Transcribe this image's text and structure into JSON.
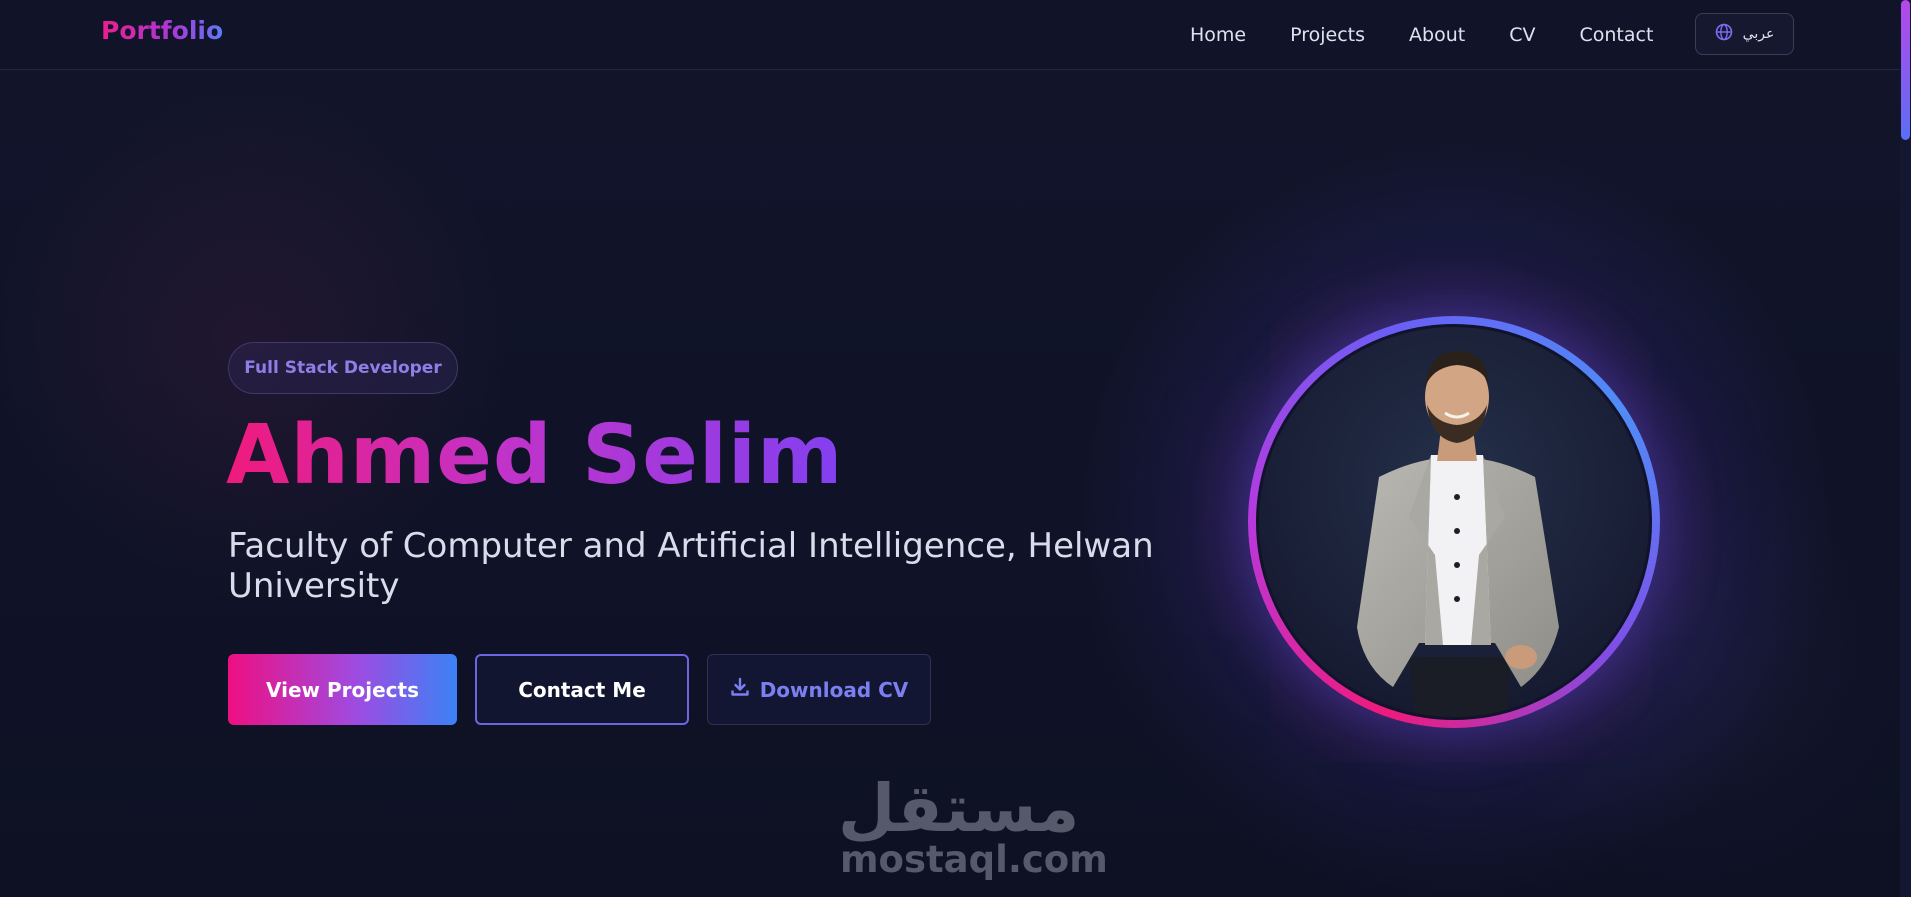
{
  "header": {
    "logo": "Portfolio",
    "nav": [
      "Home",
      "Projects",
      "About",
      "CV",
      "Contact"
    ],
    "lang_button": "عربي"
  },
  "hero": {
    "badge": "Full Stack Developer",
    "name": "Ahmed Selim",
    "subtitle": "Faculty of Computer and Artificial Intelligence, Helwan University",
    "buttons": {
      "view_projects": "View Projects",
      "contact": "Contact Me",
      "download_cv": "Download CV"
    }
  },
  "watermark": {
    "arabic": "مستقل",
    "latin": "mostaql.com"
  },
  "colors": {
    "background": "#0f1225",
    "accent_pink": "#ec1d8e",
    "accent_purple": "#8340f0",
    "accent_blue": "#3b82f6"
  },
  "icons": {
    "language": "globe-icon",
    "download": "download-icon"
  }
}
